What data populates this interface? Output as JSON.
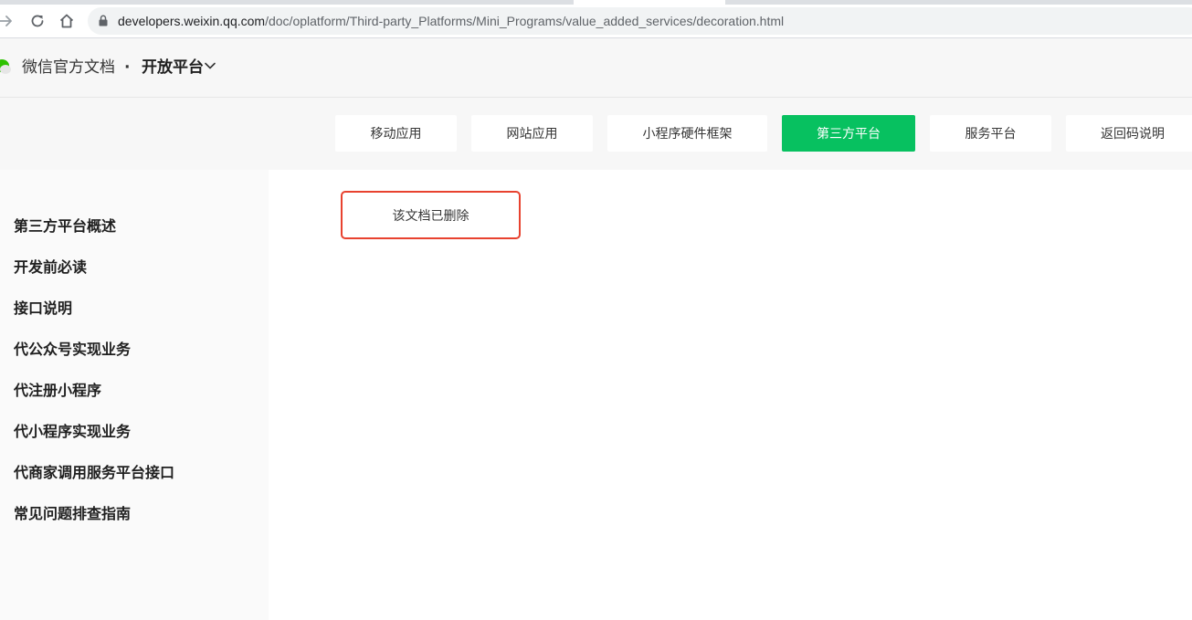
{
  "browser": {
    "url_host": "developers.weixin.qq.com",
    "url_path": "/doc/oplatform/Third-party_Platforms/Mini_Programs/value_added_services/decoration.html"
  },
  "header": {
    "brand": "微信官方文档",
    "separator": "·",
    "platform": "开放平台"
  },
  "categories": [
    {
      "label": "移动应用",
      "active": false
    },
    {
      "label": "网站应用",
      "active": false
    },
    {
      "label": "小程序硬件框架",
      "active": false
    },
    {
      "label": "第三方平台",
      "active": true
    },
    {
      "label": "服务平台",
      "active": false
    },
    {
      "label": "返回码说明",
      "active": false
    }
  ],
  "sidebar": {
    "items": [
      {
        "label": "第三方平台概述"
      },
      {
        "label": "开发前必读"
      },
      {
        "label": "接口说明"
      },
      {
        "label": "代公众号实现业务"
      },
      {
        "label": "代注册小程序"
      },
      {
        "label": "代小程序实现业务"
      },
      {
        "label": "代商家调用服务平台接口"
      },
      {
        "label": "常见问题排查指南"
      }
    ]
  },
  "main": {
    "notice": "该文档已删除"
  },
  "colors": {
    "accent": "#07c160",
    "highlight_border": "#e8422f"
  }
}
